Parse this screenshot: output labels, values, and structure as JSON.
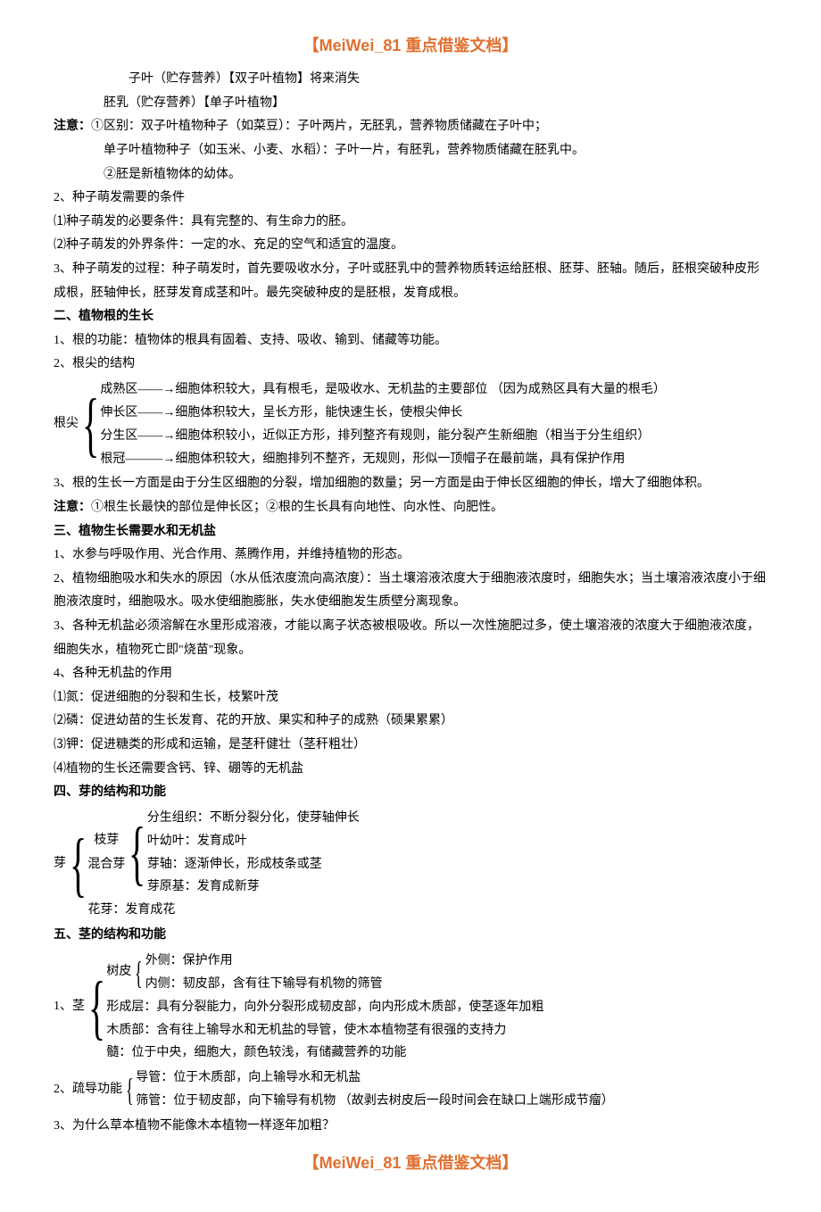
{
  "header": "【MeiWei_81 重点借鉴文档】",
  "footer": "【MeiWei_81 重点借鉴文档】",
  "lines": {
    "l1": "子叶（贮存营养）【双子叶植物】将来消失",
    "l2": "胚乳（贮存营养）【单子叶植物】",
    "l3a": "注意：",
    "l3b": "①区别：双子叶植物种子（如菜豆）：子叶两片，无胚乳，营养物质储藏在子叶中；",
    "l4": "单子叶植物种子（如玉米、小麦、水稻）：子叶一片，有胚乳，营养物质储藏在胚乳中。",
    "l5": "②胚是新植物体的幼体。",
    "l6": "2、种子萌发需要的条件",
    "l7": "⑴种子萌发的必要条件：具有完整的、有生命力的胚。",
    "l8": "⑵种子萌发的外界条件：一定的水、充足的空气和适宜的温度。",
    "l9": "3、种子萌发的过程：种子萌发时，首先要吸收水分，子叶或胚乳中的营养物质转运给胚根、胚芽、胚轴。随后，胚根突破种皮形成根，胚轴伸长，胚芽发育成茎和叶。最先突破种皮的是胚根，发育成根。",
    "s2": "二、植物根的生长",
    "l10": "1、根的功能：植物体的根具有固着、支持、吸收、输到、储藏等功能。",
    "l11": "2、根尖的结构",
    "root_label": "根尖",
    "root1": "成熟区——→细胞体积较大，具有根毛，是吸收水、无机盐的主要部位 （因为成熟区具有大量的根毛）",
    "root2": "伸长区——→细胞体积较大，呈长方形，能快速生长，使根尖伸长",
    "root3": "分生区——→细胞体积较小，近似正方形，排列整齐有规则，能分裂产生新细胞（相当于分生组织）",
    "root4": "根冠———→细胞体积较大，细胞排列不整齐，无规则，形似一顶帽子在最前端，具有保护作用",
    "l12": "3、根的生长一方面是由于分生区细胞的分裂，增加细胞的数量；另一方面是由于伸长区细胞的伸长，增大了细胞体积。",
    "l13a": "注意：",
    "l13b": "①根生长最快的部位是伸长区；②根的生长具有向地性、向水性、向肥性。",
    "s3": "三、植物生长需要水和无机盐",
    "l14": "1、水参与呼吸作用、光合作用、蒸腾作用，并维持植物的形态。",
    "l15": "2、植物细胞吸水和失水的原因（水从低浓度流向高浓度）：当土壤溶液浓度大于细胞液浓度时，细胞失水；当土壤溶液浓度小于细胞液浓度时，细胞吸水。吸水使细胞膨胀，失水使细胞发生质壁分离现象。",
    "l16": "3、各种无机盐必须溶解在水里形成溶液，才能以离子状态被根吸收。所以一次性施肥过多，使土壤溶液的浓度大于细胞液浓度，细胞失水，植物死亡即\"烧苗\"现象。",
    "l17": "4、各种无机盐的作用",
    "l18": "⑴氮：促进细胞的分裂和生长，枝繁叶茂",
    "l19": "⑵磷：促进幼苗的生长发育、花的开放、果实和种子的成熟（硕果累累）",
    "l20": "⑶钾：促进糖类的形成和运输，是茎秆健壮（茎秆粗壮）",
    "l21": "⑷植物的生长还需要含钙、锌、硼等的无机盐",
    "s4": "四、芽的结构和功能",
    "bud_label": "芽",
    "bud_a": "枝芽",
    "bud_b": "混合芽",
    "bud_c": "花芽：发育成花",
    "bud1": "分生组织：不断分裂分化，使芽轴伸长",
    "bud2": "叶幼叶：发育成叶",
    "bud3": "芽轴：逐渐伸长，形成枝条或茎",
    "bud4": "芽原基：发育成新芽",
    "s5": "五、茎的结构和功能",
    "stem_num": "1、茎",
    "stem_bark": "树皮",
    "stem_bark1": "外侧：保护作用",
    "stem_bark2": "内侧：韧皮部，含有往下输导有机物的筛管",
    "stem2": "形成层：具有分裂能力，向外分裂形成韧皮部，向内形成木质部，使茎逐年加粗",
    "stem3": "木质部：含有往上输导水和无机盐的导管，使木本植物茎有很强的支持力",
    "stem4": "髓：位于中央，细胞大，颜色较浅，有储藏营养的功能",
    "trans_label": "2、疏导功能",
    "trans1": "导管：位于木质部，向上输导水和无机盐",
    "trans2": "筛管：位于韧皮部，向下输导有机物 （故剥去树皮后一段时间会在缺口上端形成节瘤）",
    "l22": "3、为什么草本植物不能像木本植物一样逐年加粗？"
  }
}
